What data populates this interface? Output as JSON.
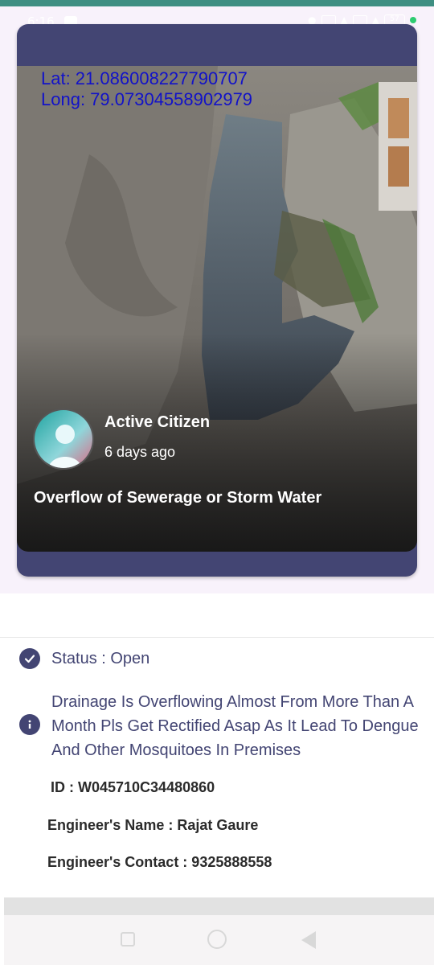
{
  "status_bar": {
    "time": "6:16",
    "battery": "57"
  },
  "post": {
    "geo": {
      "lat_text": "Lat: 21.086008227790707",
      "long_text": "Long: 79.07304558902979"
    },
    "user_name": "Active Citizen",
    "posted_ago": "6 days ago",
    "category": "Overflow of Sewerage or Storm Water"
  },
  "details": {
    "status_text": "Status : Open",
    "description": "Drainage Is Overflowing Almost From More Than A Month Pls Get Rectified Asap As It Lead To Dengue And Other Mosquitoes In Premises",
    "id_text": "ID :  W045710C34480860",
    "engineer_name_text": "Engineer's Name : Rajat Gaure",
    "engineer_contact_text": "Engineer's Contact : 9325888558"
  },
  "icons": {
    "status": "check-circle-icon",
    "description": "info-circle-icon",
    "nav_recents": "square-icon",
    "nav_home": "circle-icon",
    "nav_back": "triangle-back-icon"
  },
  "colors": {
    "primary": "#434573",
    "accent_top": "#3f8f82",
    "coord_text": "#1212c8",
    "background_lavender": "#f8f2fb"
  }
}
